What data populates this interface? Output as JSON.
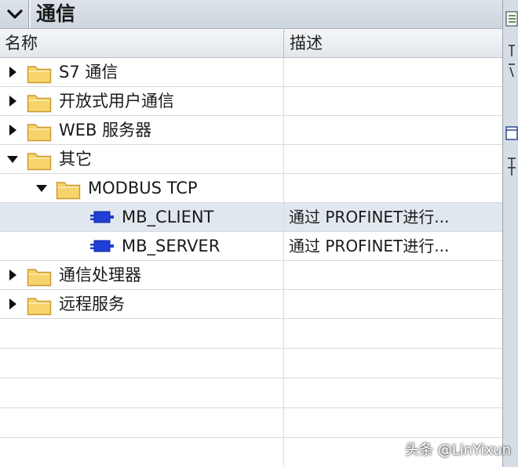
{
  "panel": {
    "title": "通信"
  },
  "columns": {
    "name": "名称",
    "description": "描述"
  },
  "tree": [
    {
      "label": "S7 通信",
      "level": 0,
      "kind": "folder",
      "expanded": false,
      "description": ""
    },
    {
      "label": "开放式用户通信",
      "level": 0,
      "kind": "folder",
      "expanded": false,
      "description": ""
    },
    {
      "label": "WEB 服务器",
      "level": 0,
      "kind": "folder",
      "expanded": false,
      "description": ""
    },
    {
      "label": "其它",
      "level": 0,
      "kind": "folder",
      "expanded": true,
      "description": ""
    },
    {
      "label": "MODBUS TCP",
      "level": 1,
      "kind": "folder",
      "expanded": true,
      "description": ""
    },
    {
      "label": "MB_CLIENT",
      "level": 2,
      "kind": "block",
      "selected": true,
      "description": "通过 PROFINET进行..."
    },
    {
      "label": "MB_SERVER",
      "level": 2,
      "kind": "block",
      "selected": false,
      "description": "通过 PROFINET进行..."
    },
    {
      "label": "通信处理器",
      "level": 0,
      "kind": "folder",
      "expanded": false,
      "description": ""
    },
    {
      "label": "远程服务",
      "level": 0,
      "kind": "folder",
      "expanded": false,
      "description": ""
    }
  ],
  "watermark": "头条 @LinYixun",
  "icons": {
    "collapse": "chevron-down-icon",
    "expanded": "triangle-down-icon",
    "collapsed": "triangle-right-icon",
    "folder": "folder-icon",
    "block": "function-block-icon"
  },
  "colors": {
    "folder_fill": "#f6d36b",
    "folder_stroke": "#c99a2e",
    "block_blue": "#1f3fd6",
    "selected_row": "#e1e7ee"
  }
}
